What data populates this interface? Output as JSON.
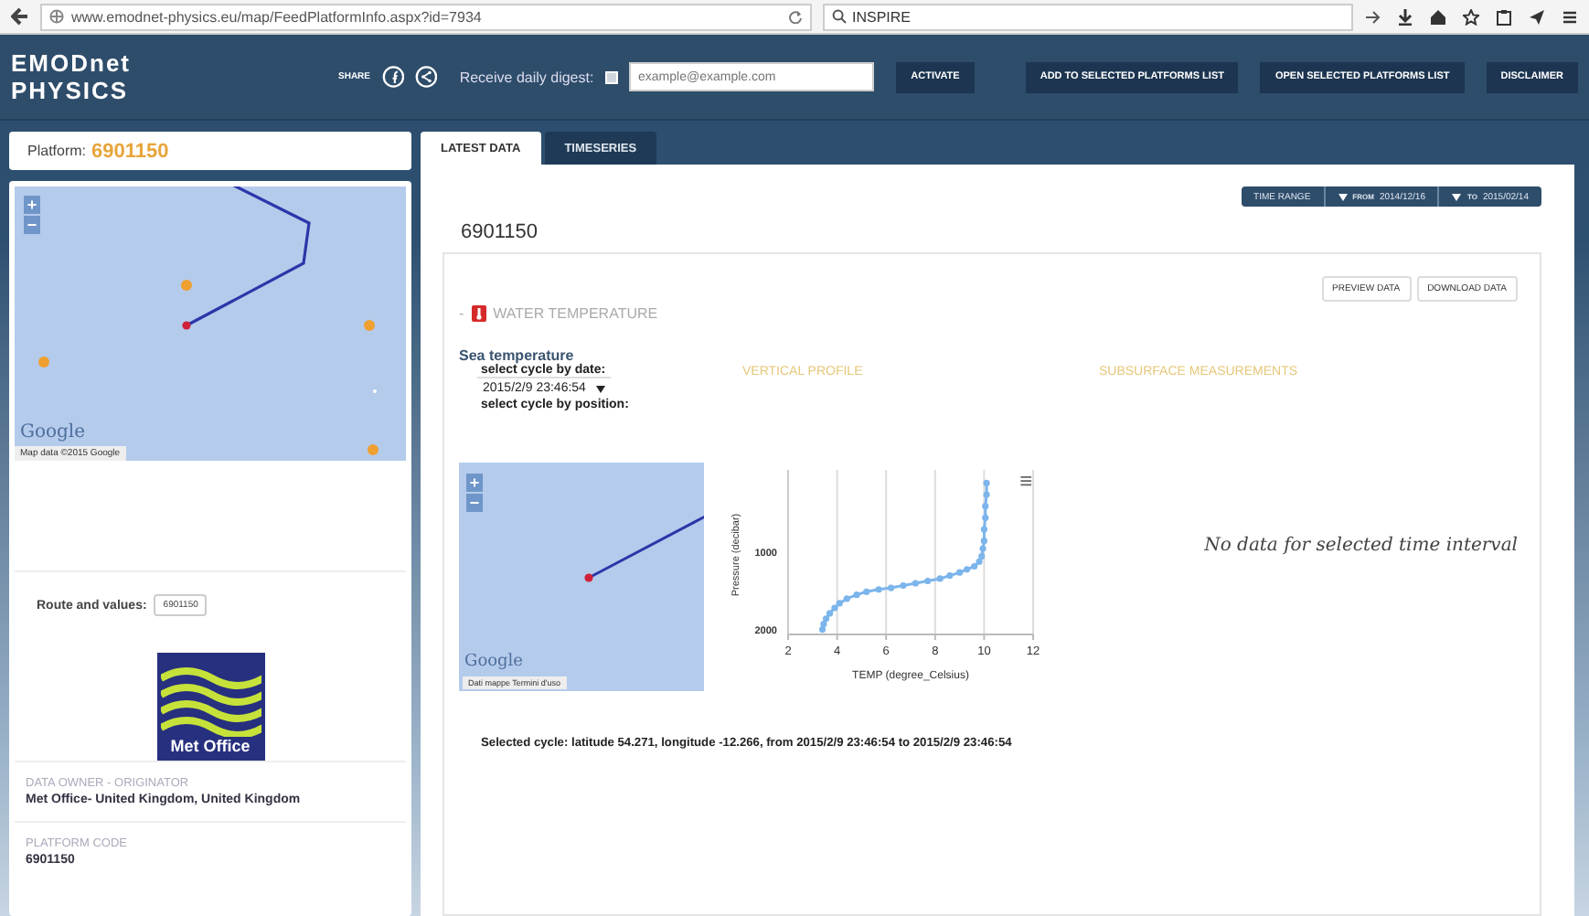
{
  "browser": {
    "url": "www.emodnet-physics.eu/map/FeedPlatformInfo.aspx?id=7934",
    "search": "INSPIRE"
  },
  "header": {
    "logo": "EMODnet PHYSICS",
    "share_label": "SHARE",
    "digest_label": "Receive daily digest:",
    "digest_checked": false,
    "email_placeholder": "example@example.com",
    "buttons": [
      "ACTIVATE",
      "ADD TO SELECTED PLATFORMS LIST",
      "OPEN SELECTED PLATFORMS LIST",
      "DISCLAIMER"
    ]
  },
  "sidebar": {
    "platform_label": "Platform:",
    "platform_code": "6901150",
    "map": {
      "zoom_in": "+",
      "zoom_out": "−",
      "logo": "Google",
      "attribution": "Map data ©2015 Google"
    },
    "route_label": "Route and values:",
    "route_value": "6901150",
    "logo_text": "Met Office",
    "info": [
      {
        "label": "DATA OWNER - ORIGINATOR",
        "value": "Met Office- United Kingdom, United Kingdom"
      },
      {
        "label": "PLATFORM CODE",
        "value": "6901150"
      }
    ]
  },
  "main": {
    "tabs": [
      {
        "label": "LATEST DATA",
        "selected": true
      },
      {
        "label": "TIMESERIES",
        "selected": false
      }
    ],
    "time_range": {
      "label": "TIME RANGE",
      "from_label": "FROM",
      "from": "2014/12/16",
      "to_label": "TO",
      "to": "2015/02/14"
    },
    "title": "6901150",
    "actions": [
      "PREVIEW DATA",
      "DOWNLOAD DATA"
    ],
    "section": {
      "toggle": "-",
      "title": "WATER TEMPERATURE"
    },
    "parameter": "Sea temperature",
    "cycle_date_label": "select cycle by date:",
    "cycle_date": "2015/2/9 23:46:54",
    "cycle_position_label": "select cycle by position:",
    "headings": [
      "VERTICAL PROFILE",
      "SUBSURFACE MEASUREMENTS"
    ],
    "mini_map": {
      "zoom_in": "+",
      "zoom_out": "−",
      "logo": "Google",
      "attribution": "Dati mappe Termini d'uso"
    },
    "chart_menu": "≡",
    "chart_data": {
      "type": "line",
      "xlabel": "TEMP (degree_Celsius)",
      "ylabel": "Pressure (decibar)",
      "x": [
        3.4,
        3.45,
        3.55,
        3.7,
        3.9,
        4.1,
        4.4,
        4.8,
        5.2,
        5.7,
        6.2,
        6.7,
        7.2,
        7.7,
        8.2,
        8.6,
        9.0,
        9.3,
        9.6,
        9.8,
        9.9,
        9.95,
        10.0,
        10.0,
        10.05,
        10.05,
        10.1,
        10.1
      ],
      "grid": true,
      "series": [
        {
          "color": "#7cb5ec",
          "marker": true,
          "values": [
            2000,
            1930,
            1860,
            1790,
            1720,
            1660,
            1600,
            1550,
            1510,
            1480,
            1460,
            1430,
            1400,
            1370,
            1340,
            1300,
            1260,
            1220,
            1180,
            1120,
            1050,
            950,
            850,
            700,
            550,
            400,
            250,
            100
          ]
        }
      ],
      "xlim": [
        2,
        12
      ],
      "ylim": [
        2064,
        0
      ],
      "xticks": [
        2,
        4,
        6,
        8,
        10,
        12
      ],
      "yticks": [
        1000,
        2000
      ]
    },
    "no_data": "No data for selected time interval",
    "selected_cycle": "Selected cycle: latitude 54.271, longitude -12.266, from 2015/2/9 23:46:54 to 2015/2/9 23:46:54"
  }
}
